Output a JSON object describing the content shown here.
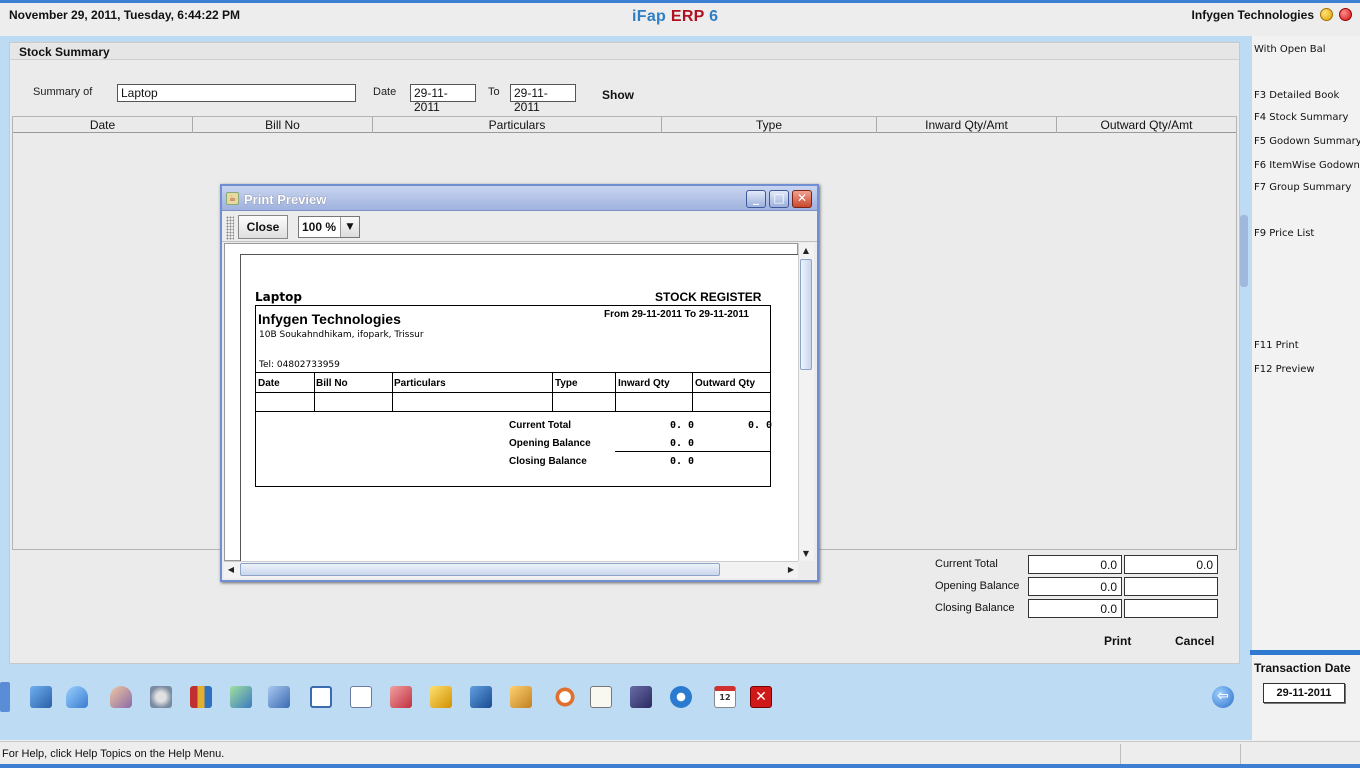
{
  "header": {
    "datetime": "November  29, 2011, Tuesday, 6:44:22 PM",
    "app_name_part1": "iFap",
    "app_name_part2": "ERP",
    "app_name_part3": "6",
    "company": "Infygen Technologies"
  },
  "panel": {
    "title": "Stock Summary",
    "summary_of_label": "Summary of",
    "summary_of_value": "Laptop",
    "date_label": "Date",
    "date_from": "29-11-2011",
    "to_label": "To",
    "date_to": "29-11-2011",
    "show_label": "Show",
    "columns": [
      "Date",
      "Bill No",
      "Particulars",
      "Type",
      "Inward Qty/Amt",
      "Outward Qty/Amt"
    ]
  },
  "totals": {
    "current_total_label": "Current Total",
    "current_total_in": "0.0",
    "current_total_out": "0.0",
    "opening_balance_label": "Opening Balance",
    "opening_balance_in": "0.0",
    "opening_balance_out": "",
    "closing_balance_label": "Closing Balance",
    "closing_balance_in": "0.0",
    "closing_balance_out": "",
    "print_label": "Print",
    "cancel_label": "Cancel"
  },
  "right_panel": {
    "items": [
      "With Open Bal",
      "F3 Detailed Book",
      "F4 Stock Summary",
      "F5 Godown Summary",
      "F6 ItemWise Godown",
      "F7 Group Summary",
      "F9 Price List",
      "F11 Print",
      "F12 Preview"
    ],
    "transaction_date_label": "Transaction Date",
    "transaction_date": "29-11-2011"
  },
  "dialog": {
    "title": "Print Preview",
    "close_label": "Close",
    "zoom": "100 %"
  },
  "report": {
    "item": "Laptop",
    "report_title": "STOCK REGISTER",
    "company": "Infygen Technologies",
    "address": "10B Soukahndhikam, ifopark, Trissur",
    "range": "From 29-11-2011 To 29-11-2011",
    "tel": "Tel: 04802733959",
    "columns": [
      "Date",
      "Bill No",
      "Particulars",
      "Type",
      "Inward Qty",
      "Outward Qty"
    ],
    "current_total_label": "Current Total",
    "current_total_in": "0. 0",
    "current_total_out": "0. 0",
    "opening_balance_label": "Opening Balance",
    "opening_balance_in": "0. 0",
    "closing_balance_label": "Closing Balance",
    "closing_balance_in": "0. 0"
  },
  "status": {
    "help_text": "For Help, click Help Topics on the Help Menu."
  },
  "toolbar": {
    "icons": [
      "company-icon",
      "user-icon",
      "contacts-icon",
      "settings-icon",
      "books-icon",
      "cart-icon",
      "transfer-icon",
      "window-icon",
      "document-icon",
      "chart-icon",
      "folder-tree-icon",
      "network-icon",
      "box-icon",
      "clock-icon",
      "calculator-icon",
      "save-icon",
      "gear-icon",
      "calendar-icon",
      "exit-icon"
    ],
    "calendar_day": "12"
  },
  "colors": {
    "accent_blue": "#2c7fc4",
    "erp_red": "#b01020",
    "background_blue": "#bddcf3"
  }
}
